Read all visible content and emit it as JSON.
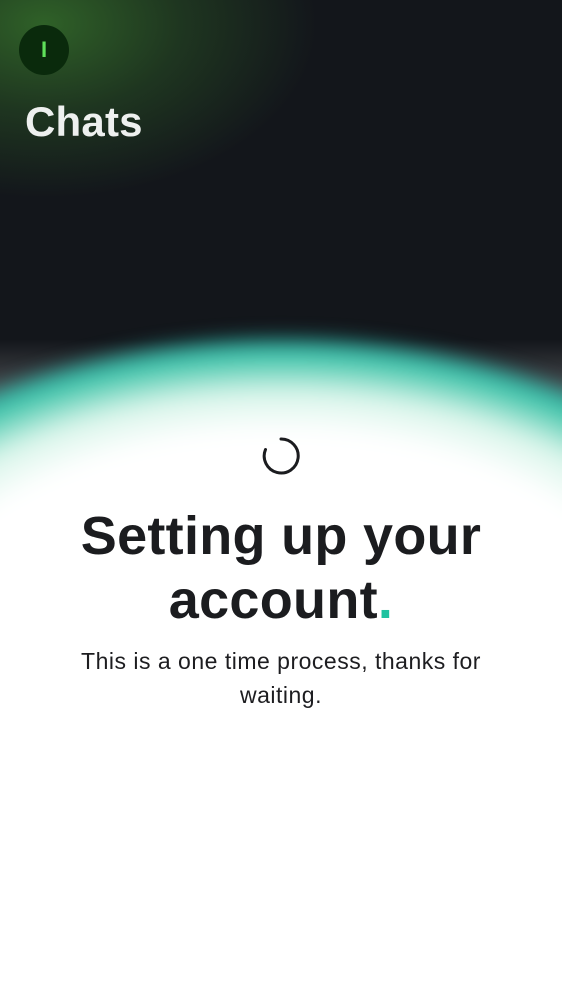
{
  "header": {
    "avatar_initial": "I",
    "title": "Chats"
  },
  "setup": {
    "heading_line1": "Setting up your",
    "heading_line2": "account",
    "heading_dot": ".",
    "subtitle": "This is a one time process, thanks for waiting."
  },
  "colors": {
    "accent": "#1fc2a0",
    "avatar_bg": "#0a2a0c",
    "avatar_text": "#5fe05a",
    "dark_bg": "#13161b",
    "text_dark": "#1b1c1f"
  },
  "icons": {
    "spinner": "loading-spinner-icon"
  }
}
